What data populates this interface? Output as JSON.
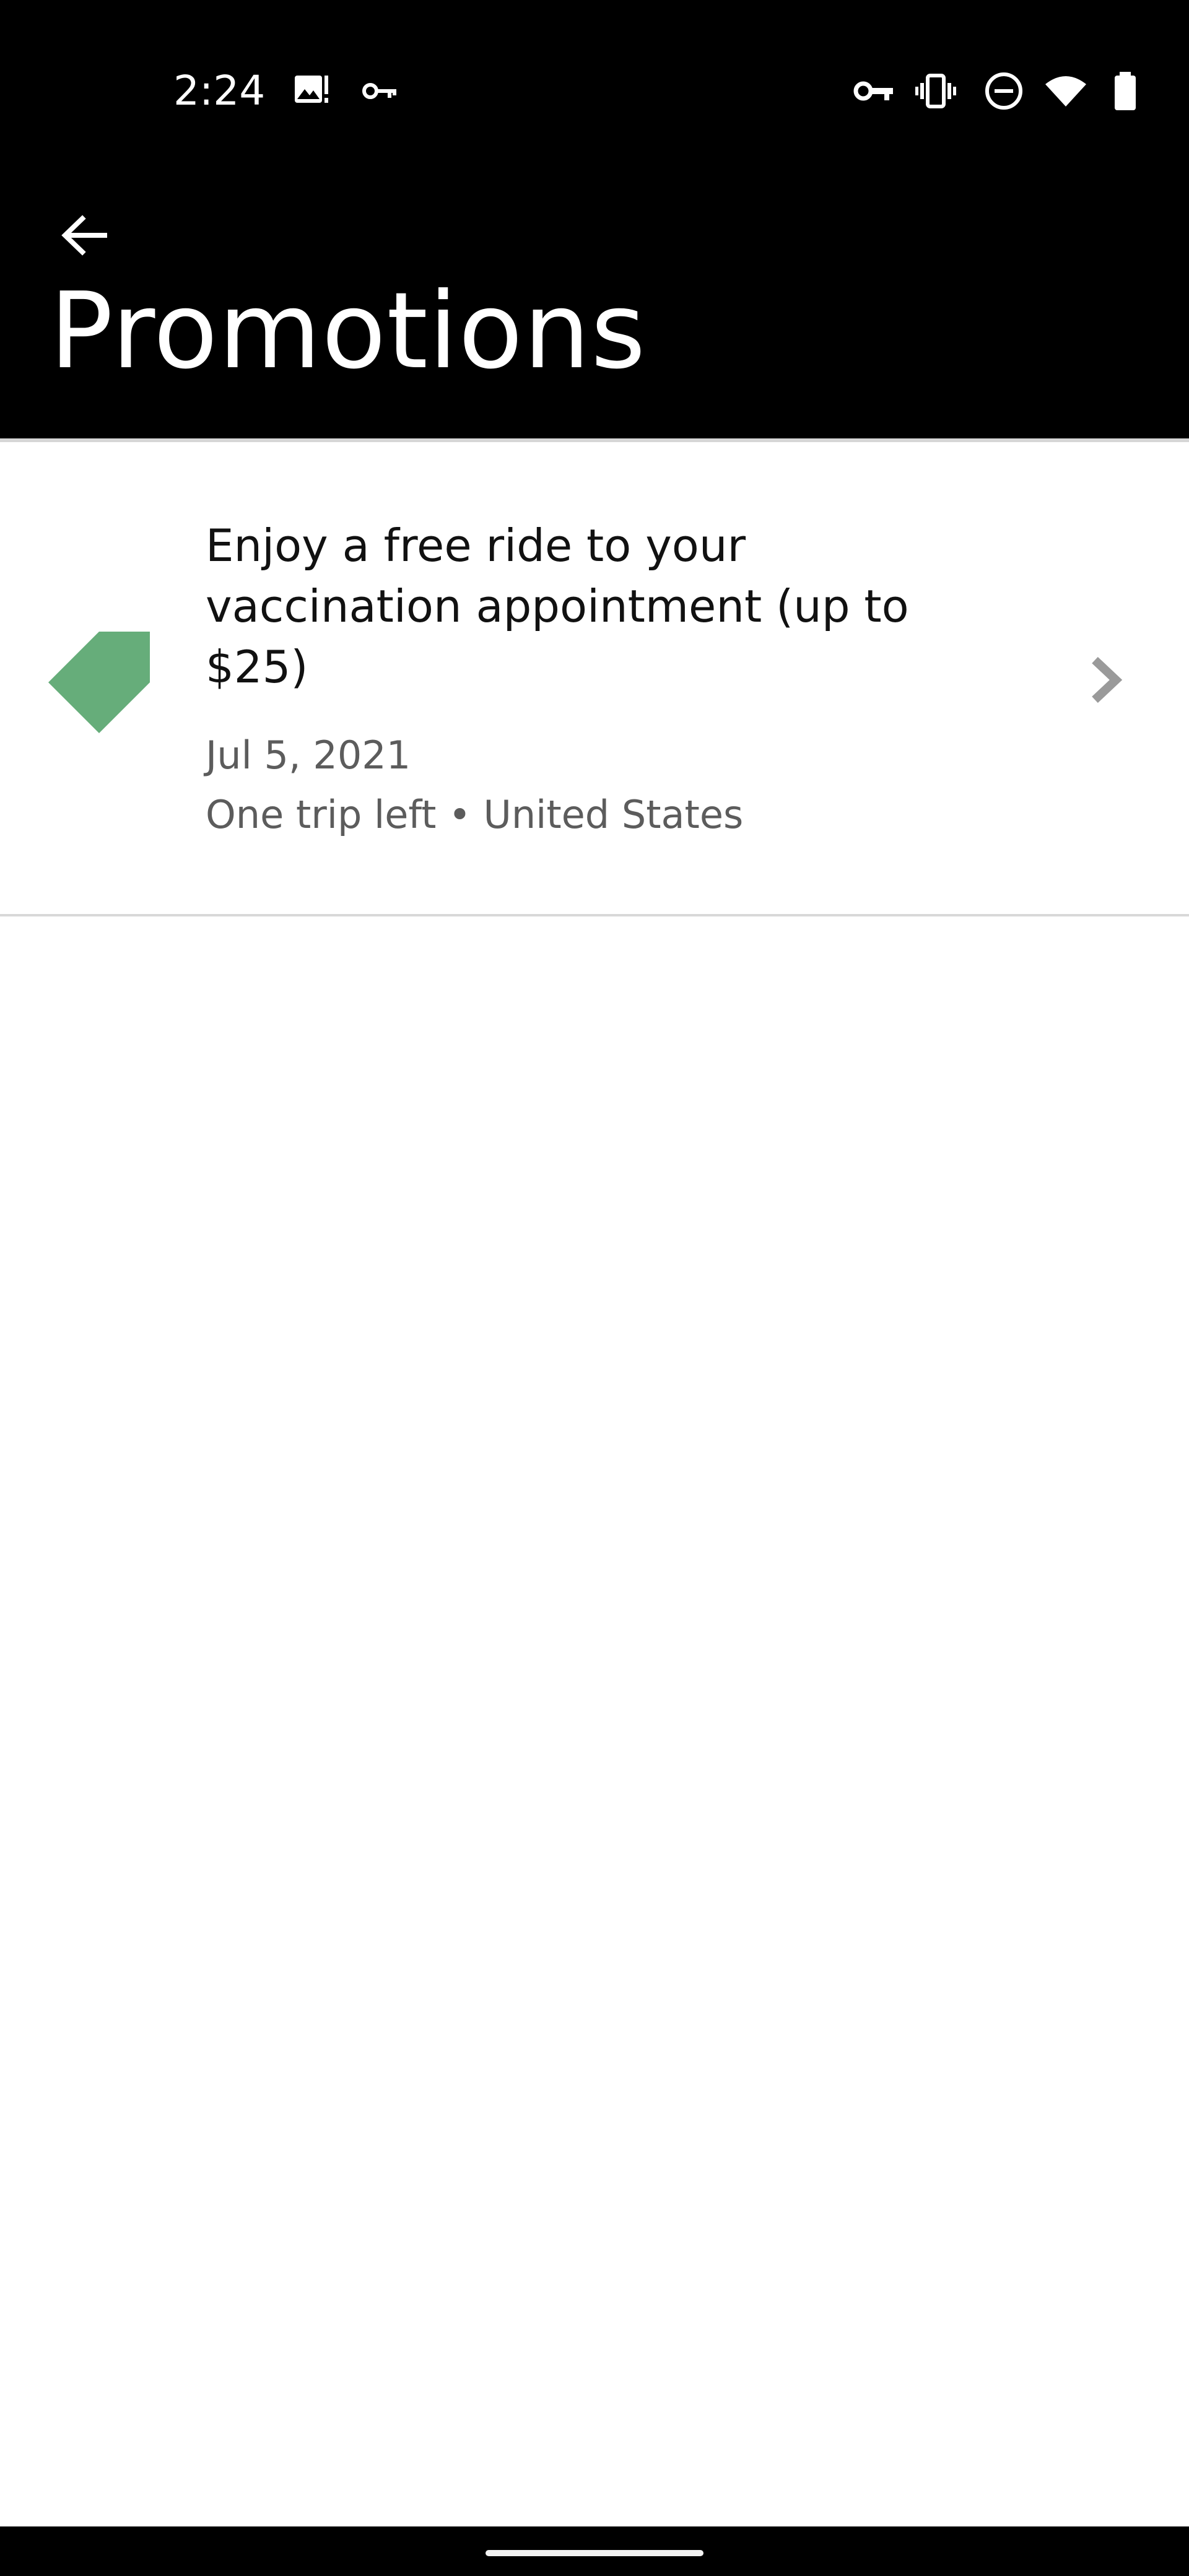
{
  "status_bar": {
    "time": "2:24",
    "left_icons": [
      "image-notification-icon",
      "key-icon"
    ],
    "right_icons": [
      "vpn-key-icon",
      "vibrate-icon",
      "do-not-disturb-icon",
      "wifi-icon",
      "battery-icon"
    ]
  },
  "header": {
    "back_icon": "arrow-left-icon",
    "title": "Promotions"
  },
  "promotions": [
    {
      "icon": "tag-icon",
      "title": "Enjoy a free ride to your vaccination appointment (up to $25)",
      "date": "Jul 5, 2021",
      "meta": "One trip left • United States"
    }
  ],
  "colors": {
    "header_bg": "#000000",
    "tag_green": "#66ad7a",
    "chevron": "#9a9a9a"
  }
}
